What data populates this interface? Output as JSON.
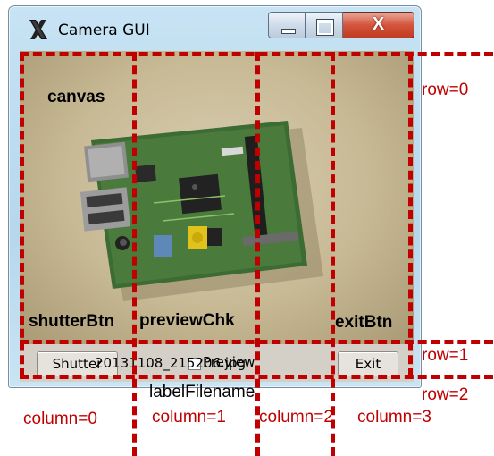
{
  "window": {
    "title": "Camera GUI",
    "close_glyph": "X"
  },
  "controls": {
    "shutter_label": "Shutter",
    "preview_label": "Preview",
    "preview_checked": false,
    "exit_label": "Exit",
    "filename": "20131108_215206.jpg"
  },
  "annotations": {
    "canvas": "canvas",
    "shutterBtn": "shutterBtn",
    "previewChk": "previewChk",
    "exitBtn": "exitBtn",
    "labelFilename": "labelFilename",
    "row0": "row=0",
    "row1": "row=1",
    "row2": "row=2",
    "col0": "column=0",
    "col1": "column=1",
    "col2": "column=2",
    "col3": "column=3"
  },
  "colors": {
    "annotation_red": "#c00000",
    "window_frame": "#c7e3f4",
    "close_button": "#d4543c"
  }
}
